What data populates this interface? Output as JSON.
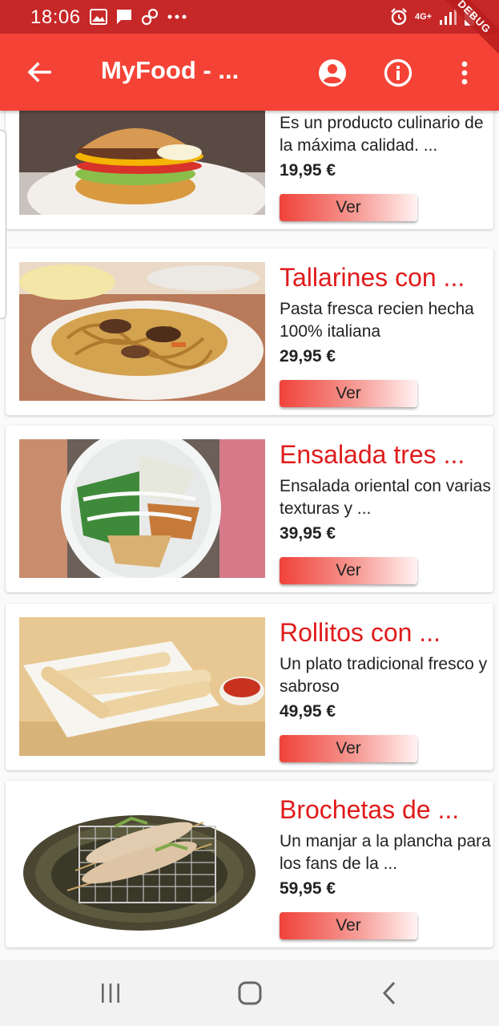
{
  "status_bar": {
    "time": "18:06",
    "network": "4G+",
    "left_icons": [
      "image-icon",
      "message-icon",
      "link-icon",
      "more-dots-icon"
    ],
    "right_icons": [
      "alarm-icon",
      "signal-icon",
      "battery-icon"
    ]
  },
  "app_bar": {
    "title": "MyFood - ...",
    "back_icon": "arrow-back-icon",
    "actions": [
      "account-icon",
      "info-icon",
      "more-vert-icon"
    ],
    "debug_banner": "DEBUG",
    "color": "#f44336"
  },
  "products": [
    {
      "name": "",
      "description": "Es un producto culinario de la máxima calidad. ...",
      "price": "19,95 €",
      "button_label": "Ver",
      "image": "burger"
    },
    {
      "name": "Tallarines con ...",
      "description": "Pasta fresca recien hecha 100% italiana",
      "price": "29,95 €",
      "button_label": "Ver",
      "image": "noodles"
    },
    {
      "name": "Ensalada tres ...",
      "description": "Ensalada oriental con varias texturas y ...",
      "price": "39,95 €",
      "button_label": "Ver",
      "image": "salad"
    },
    {
      "name": "Rollitos con ...",
      "description": "Un plato tradicional fresco y sabroso",
      "price": "49,95 €",
      "button_label": "Ver",
      "image": "rolls"
    },
    {
      "name": "Brochetas de ...",
      "description": "Un manjar a la plancha para los fans de la ...",
      "price": "59,95 €",
      "button_label": "Ver",
      "image": "skewers"
    }
  ],
  "nav_bar": {
    "buttons": [
      "recent-apps-icon",
      "home-icon",
      "back-icon"
    ]
  },
  "colors": {
    "accent": "#e01b1b",
    "status_bar": "#c62828"
  }
}
